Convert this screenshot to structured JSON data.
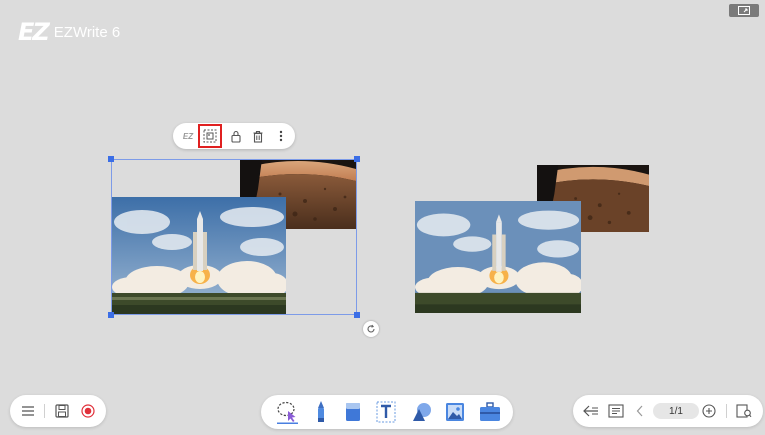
{
  "app": {
    "logo_mark": "EZ",
    "name": "EZWrite 6"
  },
  "context_toolbar": {
    "items": [
      {
        "icon": "ez-logo-icon"
      },
      {
        "icon": "image-select-icon",
        "highlighted": true
      },
      {
        "icon": "lock-icon"
      },
      {
        "icon": "trash-icon"
      },
      {
        "icon": "more-vertical-icon"
      }
    ],
    "ez_mark": "EZ"
  },
  "canvas": {
    "objects": [
      "rocket-launch-photo",
      "mars-surface-photo"
    ],
    "selection_color": "#3b6ee6"
  },
  "bottom_left": {
    "items": [
      "menu-icon",
      "save-icon",
      "record-icon"
    ],
    "record_color": "#e0303a"
  },
  "bottom_center": {
    "tools": [
      "lasso-select-icon",
      "pen-icon",
      "eraser-icon",
      "text-icon",
      "shapes-icon",
      "image-icon",
      "toolbox-icon"
    ],
    "active_tool": "lasso-select-icon"
  },
  "bottom_right": {
    "items": [
      "back-icon",
      "page-list-icon",
      "prev-page-icon",
      "add-page-icon",
      "page-overview-icon"
    ],
    "page_indicator": "1/1"
  }
}
